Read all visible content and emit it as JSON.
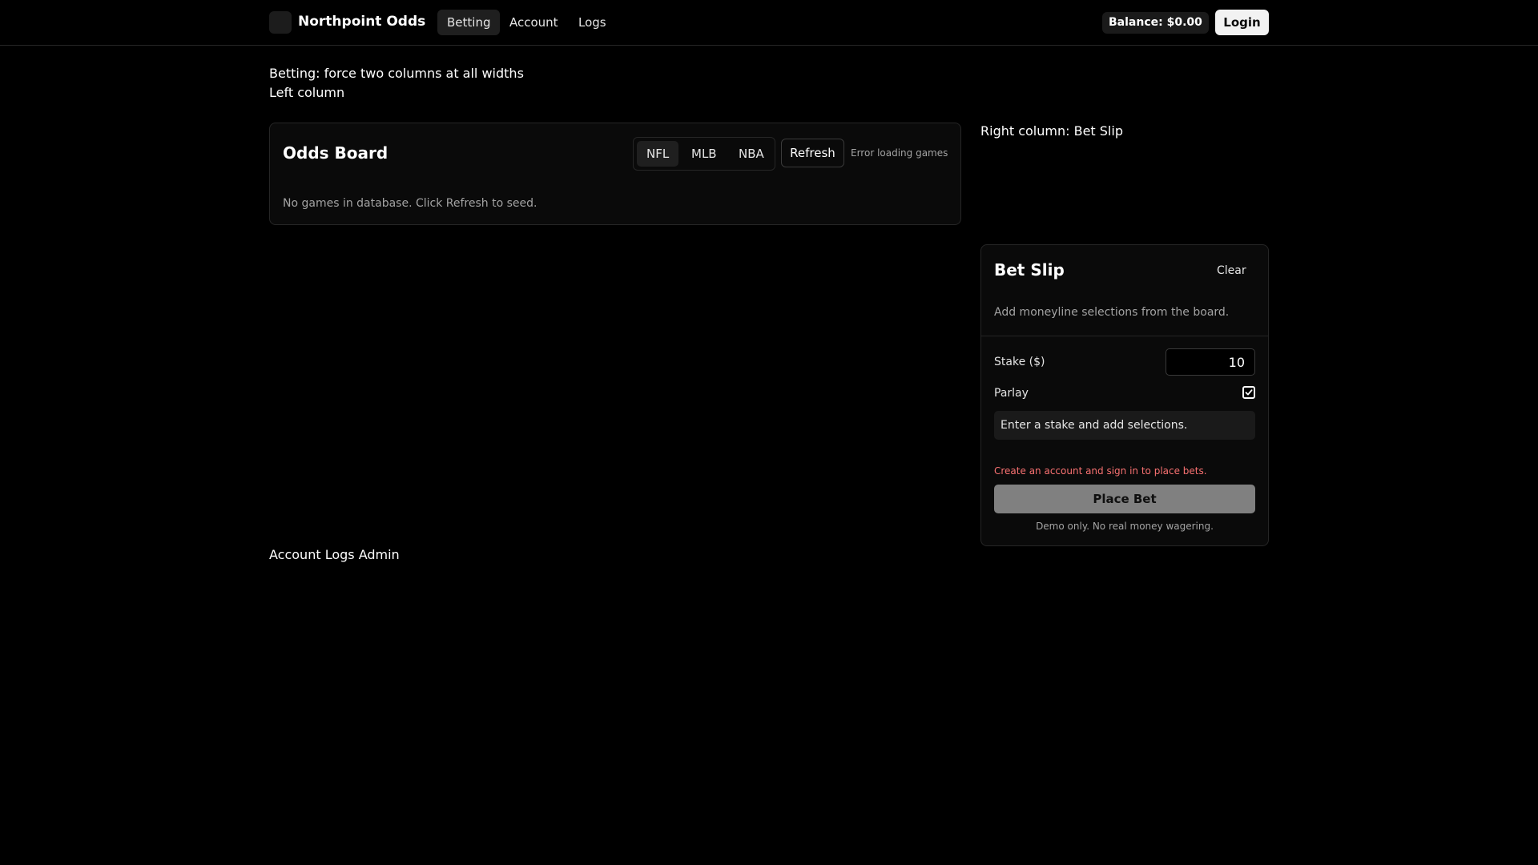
{
  "header": {
    "brand": "Northpoint Odds",
    "nav": [
      {
        "label": "Betting",
        "active": true
      },
      {
        "label": "Account",
        "active": false
      },
      {
        "label": "Logs",
        "active": false
      }
    ],
    "balance": "Balance: $0.00",
    "login_label": "Login"
  },
  "page": {
    "note_line1": "Betting: force two columns at all widths",
    "note_line2": "Left column",
    "right_column_label": "Right column: Bet Slip",
    "footer_text": "Account Logs Admin"
  },
  "odds_board": {
    "title": "Odds Board",
    "leagues": [
      {
        "label": "NFL",
        "active": true
      },
      {
        "label": "MLB",
        "active": false
      },
      {
        "label": "NBA",
        "active": false
      }
    ],
    "refresh_label": "Refresh",
    "error_text": "Error loading games",
    "empty_text": "No games in database. Click Refresh to seed."
  },
  "bet_slip": {
    "title": "Bet Slip",
    "clear_label": "Clear",
    "empty_text": "Add moneyline selections from the board.",
    "stake_label": "Stake ($)",
    "stake_value": "10",
    "parlay_label": "Parlay",
    "parlay_checked": true,
    "summary_text": "Enter a stake and add selections.",
    "warning_text": "Create an account and sign in to place bets.",
    "place_bet_label": "Place Bet",
    "disclaimer": "Demo only. No real money wagering."
  }
}
